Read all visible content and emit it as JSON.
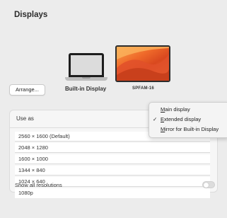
{
  "window": {
    "title": "Displays"
  },
  "displays": {
    "arrange_label": "Arrange...",
    "builtin_label": "Built-in Display",
    "external_label": "SPFAM-16"
  },
  "settings": {
    "use_as_label": "Use as",
    "resolutions": [
      "2560 × 1600 (Default)",
      "2048 × 1280",
      "1600 × 1000",
      "1344 × 840",
      "1024 × 640",
      "1080p"
    ],
    "show_all_label": "Show all resolutions",
    "show_all_enabled": false
  },
  "use_as_menu": {
    "items": [
      {
        "underline": "M",
        "rest": "ain display",
        "checked": false
      },
      {
        "underline": "E",
        "rest": "xtended display",
        "checked": true
      },
      {
        "underline": "M",
        "rest": "irror for Built-in Display",
        "checked": false
      }
    ],
    "check_glyph": "✓"
  },
  "colors": {
    "accent": "#f07a2c"
  }
}
